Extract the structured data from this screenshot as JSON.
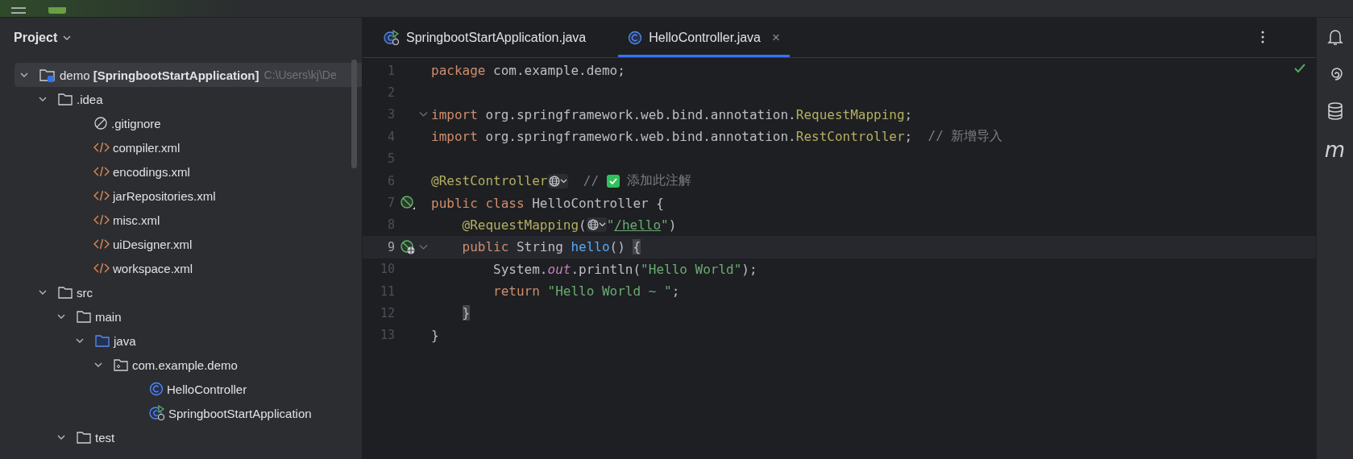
{
  "project_panel": {
    "title": "Project",
    "tree": [
      {
        "kind": "module",
        "label": "demo",
        "label_bold": "[SpringbootStartApplication]",
        "path": "C:\\Users\\kj\\De",
        "expanded": true,
        "selected": true,
        "children": [
          {
            "kind": "folder",
            "label": ".idea",
            "expanded": true,
            "selected": false,
            "children": [
              {
                "kind": "ignore",
                "label": ".gitignore",
                "selected": false
              },
              {
                "kind": "xml",
                "label": "compiler.xml",
                "selected": false
              },
              {
                "kind": "xml",
                "label": "encodings.xml",
                "selected": false
              },
              {
                "kind": "xml",
                "label": "jarRepositories.xml",
                "selected": false
              },
              {
                "kind": "xml",
                "label": "misc.xml",
                "selected": false
              },
              {
                "kind": "xml",
                "label": "uiDesigner.xml",
                "selected": false
              },
              {
                "kind": "xml",
                "label": "workspace.xml",
                "selected": false
              }
            ]
          },
          {
            "kind": "folder",
            "label": "src",
            "expanded": true,
            "selected": false,
            "children": [
              {
                "kind": "folder",
                "label": "main",
                "expanded": true,
                "selected": false,
                "children": [
                  {
                    "kind": "source",
                    "label": "java",
                    "expanded": true,
                    "selected": false,
                    "children": [
                      {
                        "kind": "package",
                        "label": "com.example.demo",
                        "expanded": true,
                        "selected": false,
                        "children": [
                          {
                            "kind": "class",
                            "label": "HelloController",
                            "selected": false
                          },
                          {
                            "kind": "app",
                            "label": "SpringbootStartApplication",
                            "selected": false
                          }
                        ]
                      }
                    ]
                  }
                ]
              },
              {
                "kind": "folder",
                "label": "test",
                "expanded": true,
                "selected": false
              }
            ]
          }
        ]
      }
    ]
  },
  "tabs": [
    {
      "kind": "app",
      "label": "SpringbootStartApplication.java",
      "selected": false
    },
    {
      "kind": "class",
      "label": "HelloController.java",
      "selected": true,
      "close": "×"
    }
  ],
  "editor": {
    "lines": [
      {
        "number": "1",
        "tokens": [
          {
            "kind": "kw",
            "t": "package "
          },
          {
            "kind": "plain",
            "t": "com.example.demo;"
          }
        ]
      },
      {
        "number": "2"
      },
      {
        "number": "3",
        "fold": true,
        "tokens": [
          {
            "kind": "kw",
            "t": "import "
          },
          {
            "kind": "plain",
            "t": "org.springframework.web.bind.annotation."
          },
          {
            "kind": "ann",
            "t": "RequestMapping"
          },
          {
            "kind": "plain",
            "t": ";"
          }
        ]
      },
      {
        "number": "4",
        "tokens": [
          {
            "kind": "kw",
            "t": "import "
          },
          {
            "kind": "plain",
            "t": "org.springframework.web.bind.annotation."
          },
          {
            "kind": "ann",
            "t": "RestController"
          },
          {
            "kind": "plain",
            "t": ";  "
          },
          {
            "kind": "comment",
            "t": "// 新增导入"
          }
        ]
      },
      {
        "number": "5"
      },
      {
        "number": "6",
        "tokens": [
          {
            "kind": "ann",
            "t": "@RestController"
          },
          {
            "kind": "inlay"
          },
          {
            "kind": "comment",
            "t": "  // "
          },
          {
            "kind": "check"
          },
          {
            "kind": "comment",
            "t": " 添加此注解"
          }
        ]
      },
      {
        "number": "7",
        "gutter": {
          "kind": "bean"
        },
        "tokens": [
          {
            "kind": "kw",
            "t": "public class "
          },
          {
            "kind": "plain",
            "t": "HelloController {"
          }
        ]
      },
      {
        "number": "8",
        "tokens": [
          {
            "kind": "ann",
            "t": "    @RequestMapping"
          },
          {
            "kind": "plain",
            "t": "("
          },
          {
            "kind": "inlay"
          },
          {
            "kind": "str",
            "t": "\""
          },
          {
            "kind": "url",
            "t": "/hello"
          },
          {
            "kind": "str",
            "t": "\""
          },
          {
            "kind": "plain",
            "t": ")"
          }
        ]
      },
      {
        "number": "9",
        "gutter": {
          "kind": "bean-web"
        },
        "fold": true,
        "current": true,
        "tokens": [
          {
            "kind": "kw",
            "t": "    public "
          },
          {
            "kind": "plain",
            "t": "String "
          },
          {
            "kind": "method",
            "t": "hello"
          },
          {
            "kind": "plain",
            "t": "() "
          },
          {
            "kind": "brace",
            "t": "{"
          }
        ]
      },
      {
        "number": "10",
        "tokens": [
          {
            "kind": "plain",
            "t": "        System."
          },
          {
            "kind": "field",
            "t": "out"
          },
          {
            "kind": "plain",
            "t": ".println("
          },
          {
            "kind": "str",
            "t": "\"Hello World\""
          },
          {
            "kind": "plain",
            "t": ");"
          }
        ]
      },
      {
        "number": "11",
        "tokens": [
          {
            "kind": "kw",
            "t": "        return "
          },
          {
            "kind": "str",
            "t": "\"Hello World ~ \""
          },
          {
            "kind": "plain",
            "t": ";"
          }
        ]
      },
      {
        "number": "12",
        "tokens": [
          {
            "kind": "brace",
            "t": "    }"
          }
        ]
      },
      {
        "number": "13",
        "tokens": [
          {
            "kind": "plain",
            "t": "}"
          }
        ]
      }
    ]
  },
  "right_toolbar": [
    {
      "kind": "bell"
    },
    {
      "kind": "spiral"
    },
    {
      "kind": "database"
    },
    {
      "kind": "letter",
      "text": "m"
    }
  ]
}
